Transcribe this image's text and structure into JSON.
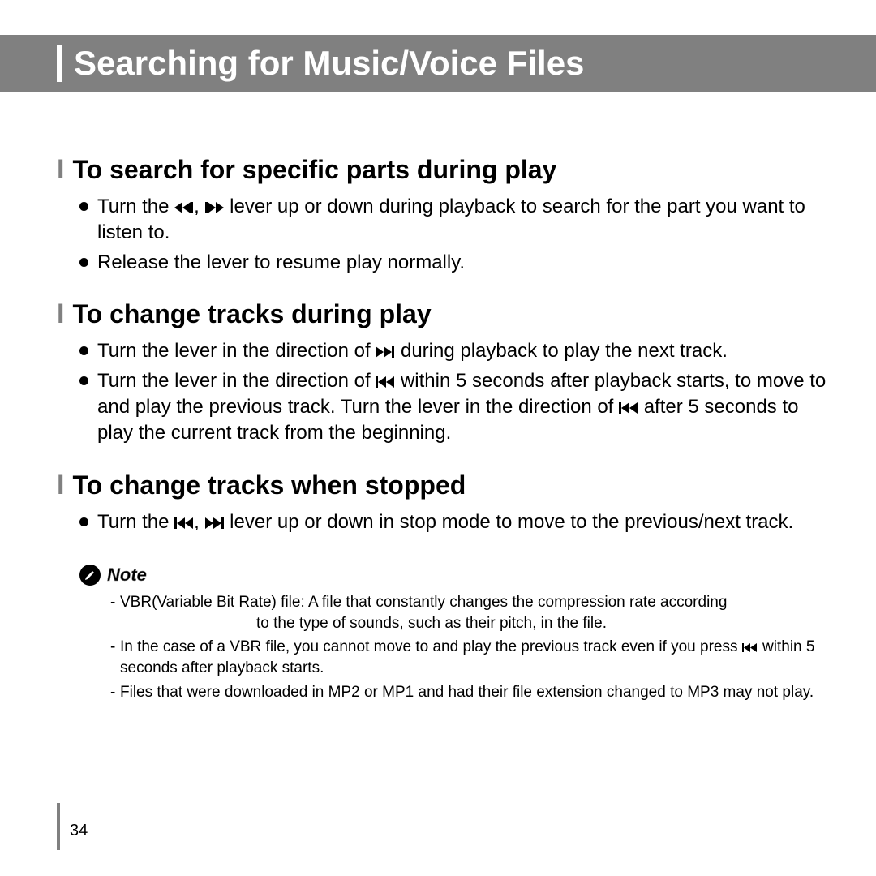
{
  "header": {
    "title": "Searching for Music/Voice Files"
  },
  "sections": [
    {
      "title": "To search for specific parts during play",
      "bullets": [
        {
          "pre": "Turn the ",
          "icons": "both",
          "post": " lever up or down during playback to search for the part you want to listen to."
        },
        {
          "pre": "Release the lever to resume play normally.",
          "icons": "",
          "post": ""
        }
      ]
    },
    {
      "title": "To change tracks during play",
      "bullets": [
        {
          "pre": "Turn the lever in the direction of ",
          "icons": "fwd",
          "post": " during playback to play the next track."
        },
        {
          "pre": "Turn the lever in the direction of ",
          "icons": "rew",
          "mid": " within 5 seconds after playback starts, to move to and play the previous track. Turn the lever in the direction of ",
          "icons2": "rew",
          "post": " after 5 seconds to play the current track from the beginning."
        }
      ]
    },
    {
      "title": "To change tracks when stopped",
      "bullets": [
        {
          "pre": "Turn the ",
          "icons": "both",
          "post": " lever up or down in stop mode to move to the previous/next track."
        }
      ]
    }
  ],
  "note": {
    "label": "Note",
    "items": [
      {
        "line1": "VBR(Variable Bit Rate) file: A file that constantly changes the compression rate according",
        "line2": "to the type of sounds, such as their pitch, in the file."
      },
      {
        "pre": "In the case of a VBR file, you cannot move to and play the previous track even if you press ",
        "icons": "rew",
        "post": " within 5 seconds after playback starts."
      },
      {
        "line1": "Files that were downloaded in MP2 or MP1 and had their file extension changed to MP3 may not play."
      }
    ]
  },
  "page": "34"
}
